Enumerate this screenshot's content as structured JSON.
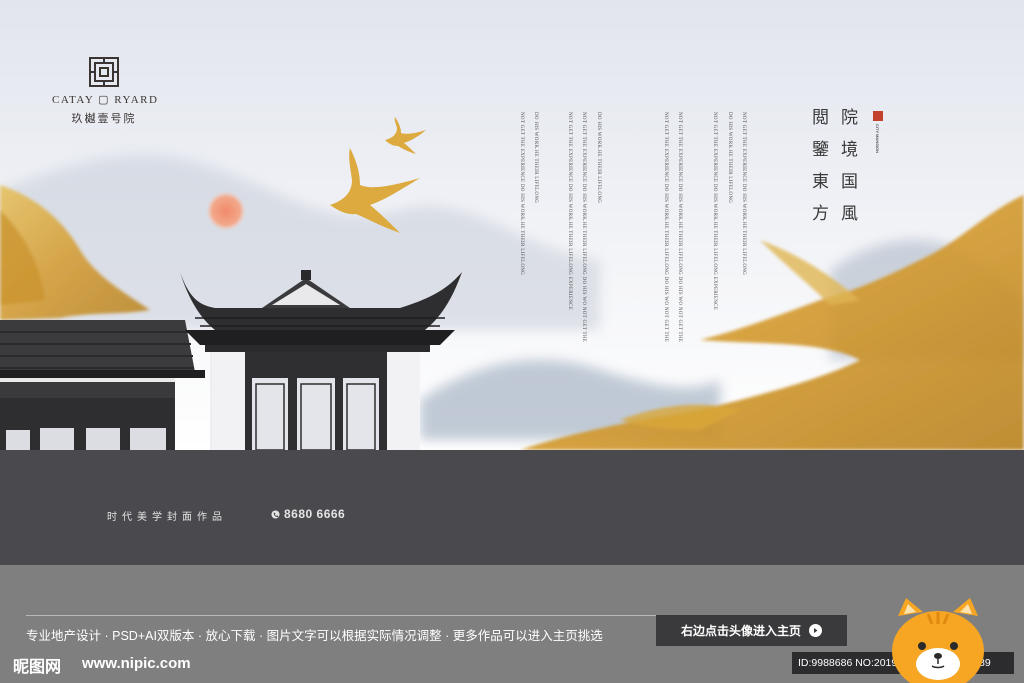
{
  "brand": {
    "name_en": "CATAY ▢ RYARD",
    "name_cn": "玖樾壹号院"
  },
  "headline": {
    "col1": "院境国風",
    "col2": "閲鑒東方"
  },
  "seal_text": "CITY MANSION",
  "english_columns": [
    "NOT GET THE EXPERIENCE DO HIS WORK.HE THEIR LIFELONG",
    "DO HIS WORK.HE THEIR LIFELONG",
    "NOT GET THE EXPERIENCE DO HIS WORK.HE THEIR LIFELONG EXPERIENCE",
    "NOT GET THE EXPERIENCE DO HIS WORK.HE THEIR LIFELONG DO HIS WO NOT GET THE",
    "DO HIS WORK.HE THEIR LIFELONG",
    "NOT GET THE EXPERIENCE DO HIS WORK.HE THEIR LIFELONG DO HIS WO NOT GET THE",
    "NOT GET THE EXPERIENCE DO HIS WORK.HE THEIR LIFELONG DO HIS WO NOT GET THE",
    "NOT GET THE EXPERIENCE DO HIS WORK.HE THEIR LIFELONG EXPERIENCE",
    "DO HIS WORK.HE THEIR LIFELONG",
    "NOT GET THE EXPERIENCE DO HIS WORK.HE THEIR LIFELONG"
  ],
  "band": {
    "slogan": "时代美学封面作品",
    "phone": "8680 6666"
  },
  "footer": {
    "info": "专业地产设计 · PSD+AI双版本 · 放心下载 · 图片文字可以根据实际情况调整 · 更多作品可以进入主页挑选",
    "button_label": "右边点击头像进入主页",
    "watermark_logo": "昵图网",
    "watermark_site": "www.nipic.com",
    "id_text": "ID:9988686 NO:20190830155423651089"
  },
  "colors": {
    "gold": "#d9a63a",
    "band": "#4a494e",
    "footer": "#7f7f80",
    "button": "#3a3a3c",
    "seal": "#c3402c",
    "cat": "#f6a623"
  },
  "icons": {
    "logo": "lattice-logo-icon",
    "phone": "phone-icon",
    "arrow": "arrow-right-icon",
    "swallow": "swallow-icon",
    "sun": "sun-icon",
    "avatar": "cat-avatar-icon"
  }
}
